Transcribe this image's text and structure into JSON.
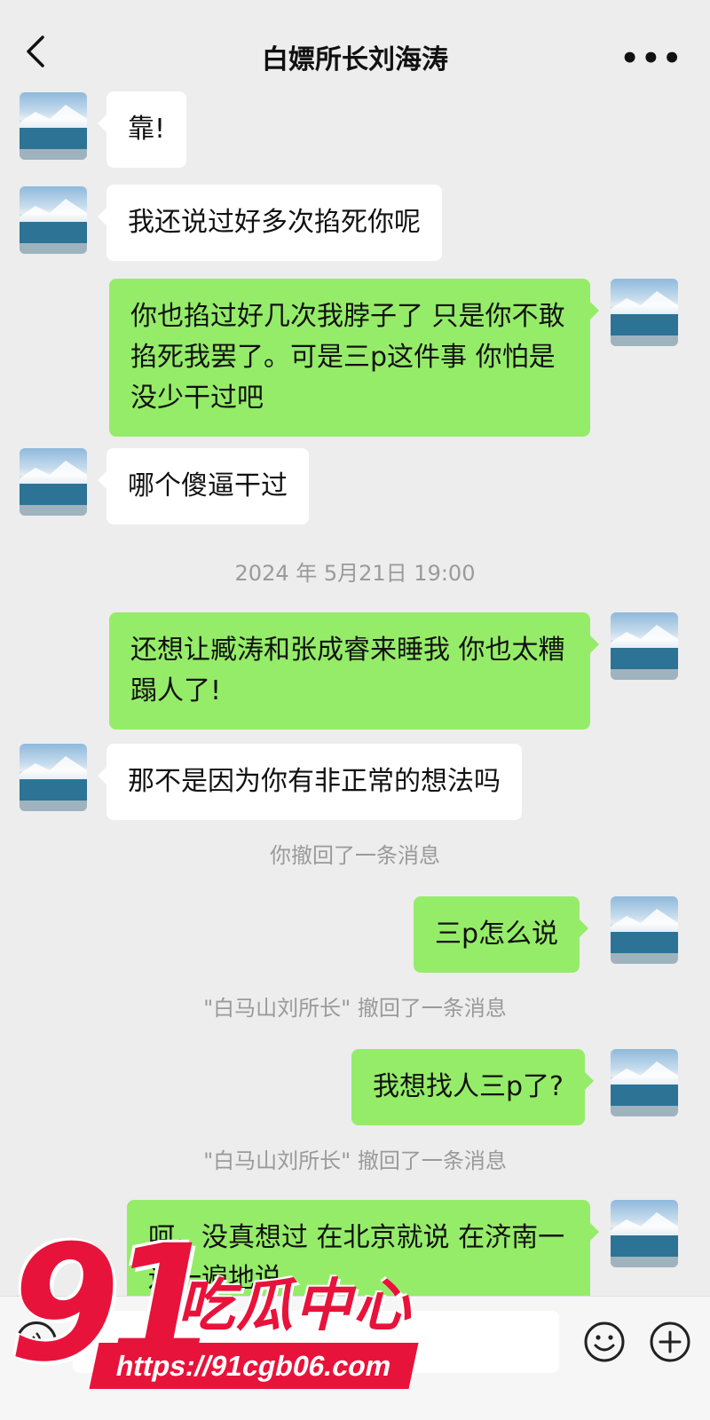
{
  "header": {
    "back_icon": "chevron-left-icon",
    "title": "白嫖所长刘海涛",
    "more_label": "•••"
  },
  "messages": [
    {
      "side": "in",
      "text": "靠!"
    },
    {
      "side": "in",
      "text": "我还说过好多次掐死你呢"
    },
    {
      "side": "out",
      "text": "你也掐过好几次我脖子了 只是你不敢掐死我罢了。可是三p这件事 你怕是没少干过吧"
    },
    {
      "side": "in",
      "text": "哪个傻逼干过"
    },
    {
      "side": "out",
      "text": "还想让臧涛和张成睿来睡我 你也太糟蹋人了!"
    },
    {
      "side": "in",
      "text": "那不是因为你有非正常的想法吗"
    },
    {
      "side": "out",
      "text": "三p怎么说"
    },
    {
      "side": "out",
      "text": "我想找人三p了?"
    },
    {
      "side": "out",
      "text": "呵。没真想过 在北京就说 在济南一遍一遍地说"
    }
  ],
  "system": {
    "timestamp": "2024 年 5月21日 19:00",
    "recall_self": "你撤回了一条消息",
    "recall_other_1": "\"白马山刘所长\" 撤回了一条消息",
    "recall_other_2": "\"白马山刘所长\" 撤回了一条消息"
  },
  "input_bar": {
    "voice_icon": "voice-icon",
    "emoji_icon": "emoji-icon",
    "plus_icon": "plus-icon"
  },
  "watermark": {
    "number": "91",
    "name": "吃瓜中心",
    "url": "https://91cgb06.com"
  },
  "colors": {
    "background": "#ededed",
    "bubble_in": "#ffffff",
    "bubble_out": "#95ec69",
    "watermark": "#e8133a"
  }
}
